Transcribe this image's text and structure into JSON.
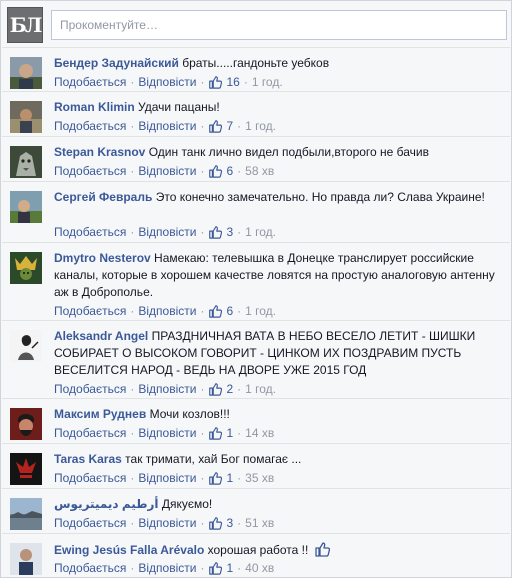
{
  "composer": {
    "placeholder": "Прокоментуйте…",
    "logo_text": "БЛ"
  },
  "actions": {
    "like_label": "Подобається",
    "reply_label": "Відповісти",
    "separator": "·"
  },
  "comments": [
    {
      "author": "Бендер Задунайский",
      "text": "браты.....гандоньте уебков",
      "likes": "16",
      "time": "1 год."
    },
    {
      "author": "Roman Klimin",
      "text": "Удачи пацаны!",
      "likes": "7",
      "time": "1 год."
    },
    {
      "author": "Stepan Krasnov",
      "text": "Один танк лично видел подбыли,второго не бачив",
      "likes": "6",
      "time": "58 хв"
    },
    {
      "author": "Сергей Февраль",
      "text": "Это конечно замечательно. Но правда ли? Слава Украине!",
      "likes": "3",
      "time": "1 год."
    },
    {
      "author": "Dmytro Nesterov",
      "text": "Намекаю: телевышка в Донецке транслирует российские каналы, которые в хорошем качестве ловятся на простую аналоговую антенну аж в Доброполье.",
      "likes": "6",
      "time": "1 год."
    },
    {
      "author": "Aleksandr Angel",
      "text": "ПРАЗДНИЧНАЯ ВАТА В НЕБО ВЕСЕЛО ЛЕТИТ - ШИШКИ СОБИРАЕТ О ВЫСОКОМ ГОВОРИТ - ЦИНКОМ ИХ ПОЗДРАВИМ ПУСТЬ ВЕСЕЛИТСЯ НАРОД - ВЕДЬ НА ДВОРЕ УЖЕ 2015 ГОД",
      "likes": "2",
      "time": "1 год."
    },
    {
      "author": "Максим Руднев",
      "text": "Мочи козлов!!!",
      "likes": "1",
      "time": "14 хв"
    },
    {
      "author": "Taras Karas",
      "text": "так тримати, хай Бог помагає ...",
      "likes": "1",
      "time": "35 хв"
    },
    {
      "author": "أرطيم ديميتريوس",
      "text": "Дякуємо!",
      "likes": "3",
      "time": "51 хв"
    },
    {
      "author": "Ewing Jesús Falla Arévalo",
      "text": "хорошая работа !!",
      "likes": "1",
      "time": "40 хв"
    }
  ],
  "colors": {
    "link": "#3b5998",
    "meta": "#9197a3",
    "background": "#f6f7f9"
  }
}
